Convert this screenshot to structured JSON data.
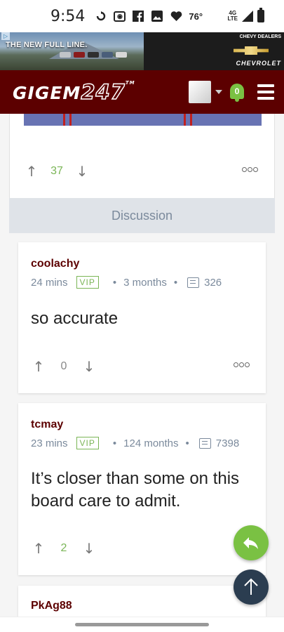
{
  "status_bar": {
    "time": "9:54",
    "temperature": "76°",
    "network_top": "4G",
    "network_bottom": "LTE",
    "icons": [
      "sync-icon",
      "radio-icon",
      "facebook-icon",
      "image-icon",
      "heart-icon",
      "signal-icon",
      "battery-icon"
    ]
  },
  "ad": {
    "headline": "THE NEW FULL LINE.",
    "dealers": "CHEVY DEALERS",
    "brand": "CHEVROLET"
  },
  "header": {
    "logo_text": "GIGEM",
    "logo_number": "247",
    "logo_tm": "TM",
    "notification_count": "0",
    "colors": {
      "brand": "#5c0000",
      "accent": "#7ac143"
    }
  },
  "post": {
    "upvotes": "37"
  },
  "discussion": {
    "label": "Discussion"
  },
  "comments": [
    {
      "username": "coolachy",
      "time_ago": "24 mins",
      "badge": "VIP",
      "member_for": "3 months",
      "post_count": "326",
      "body": "so accurate",
      "votes": "0"
    },
    {
      "username": "tcmay",
      "time_ago": "23 mins",
      "badge": "VIP",
      "member_for": "124 months",
      "post_count": "7398",
      "body": "It’s closer than some on this board care to admit.",
      "votes": "2"
    },
    {
      "username": "PkAg88"
    }
  ],
  "arrows": {
    "up": "↑",
    "down": "↓"
  }
}
